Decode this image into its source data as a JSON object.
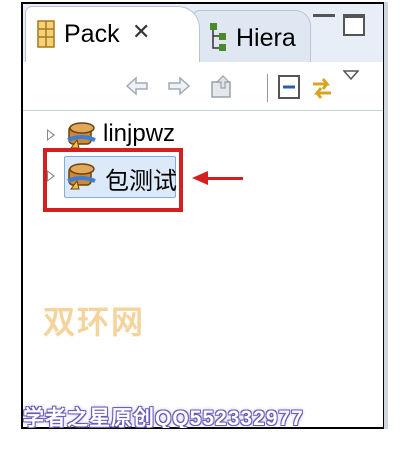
{
  "tabs": [
    {
      "label": "Pack",
      "icon": "package-explorer-icon",
      "active": true,
      "close": "✕"
    },
    {
      "label": "Hiera",
      "icon": "hierarchy-icon",
      "active": false
    }
  ],
  "toolbar": {
    "buttons": [
      "back-arrow-icon",
      "forward-arrow-icon",
      "up-folder-icon",
      "collapse-all-icon",
      "link-with-editor-icon",
      "view-menu-icon"
    ]
  },
  "tree": {
    "items": [
      {
        "label": "linjpwz",
        "icon": "project-icon"
      },
      {
        "label": "包测试",
        "icon": "project-icon",
        "selected": true
      }
    ]
  },
  "watermark": "双环网",
  "footer_watermark": "学者之星原创QQ552332977",
  "colors": {
    "highlight": "#d31f1f",
    "selection": "#dbe9f8",
    "tab_bg": "#e8eef7"
  }
}
